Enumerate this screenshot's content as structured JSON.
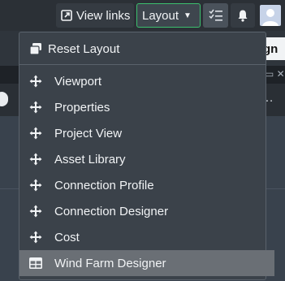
{
  "topbar": {
    "view_links_label": "View links",
    "layout_label": "Layout",
    "layout_accent": "#3cbf6e"
  },
  "background": {
    "sign_button_partial": "gn"
  },
  "menu": {
    "reset_label": "Reset Layout",
    "items": [
      {
        "label": "Viewport",
        "icon": "move-arrows-icon"
      },
      {
        "label": "Properties",
        "icon": "move-arrows-icon"
      },
      {
        "label": "Project View",
        "icon": "move-arrows-icon"
      },
      {
        "label": "Asset Library",
        "icon": "move-arrows-icon"
      },
      {
        "label": "Connection Profile",
        "icon": "move-arrows-icon"
      },
      {
        "label": "Connection Designer",
        "icon": "move-arrows-icon"
      },
      {
        "label": "Cost",
        "icon": "move-arrows-icon"
      },
      {
        "label": "Wind Farm Designer",
        "icon": "table-icon",
        "active": true
      }
    ]
  }
}
